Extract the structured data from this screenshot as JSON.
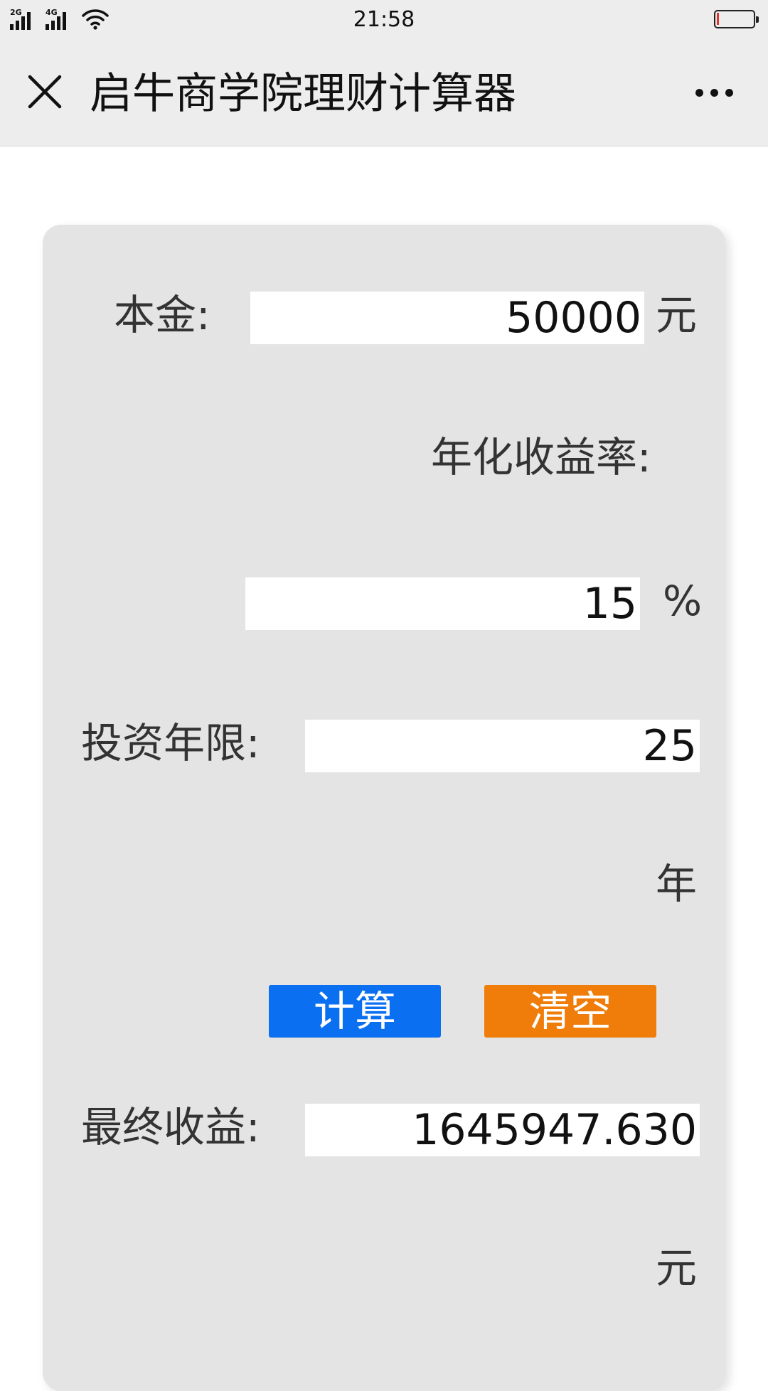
{
  "status_bar": {
    "sim1": "2G",
    "sim2": "4G",
    "time": "21:58",
    "battery_level": 0.05,
    "battery_color": "#e3342f"
  },
  "header": {
    "close_icon": "close-icon",
    "title": "启牛商学院理财计算器",
    "more_icon": "more-dots-icon"
  },
  "calculator": {
    "principal": {
      "label": "本金:",
      "value": "50000",
      "unit": "元"
    },
    "rate": {
      "label": "年化收益率:",
      "value": "15",
      "unit": "%"
    },
    "years": {
      "label": "投资年限:",
      "value": "25",
      "unit": "年"
    },
    "buttons": {
      "calculate": "计算",
      "calculate_color": "#0a6ff0",
      "clear": "清空",
      "clear_color": "#f07d0a"
    },
    "result": {
      "label": "最终收益:",
      "value": "1645947.630",
      "unit": "元"
    }
  },
  "colors": {
    "page_bg": "#ffffff",
    "bar_bg": "#ededed",
    "card_bg": "#e4e4e4"
  }
}
